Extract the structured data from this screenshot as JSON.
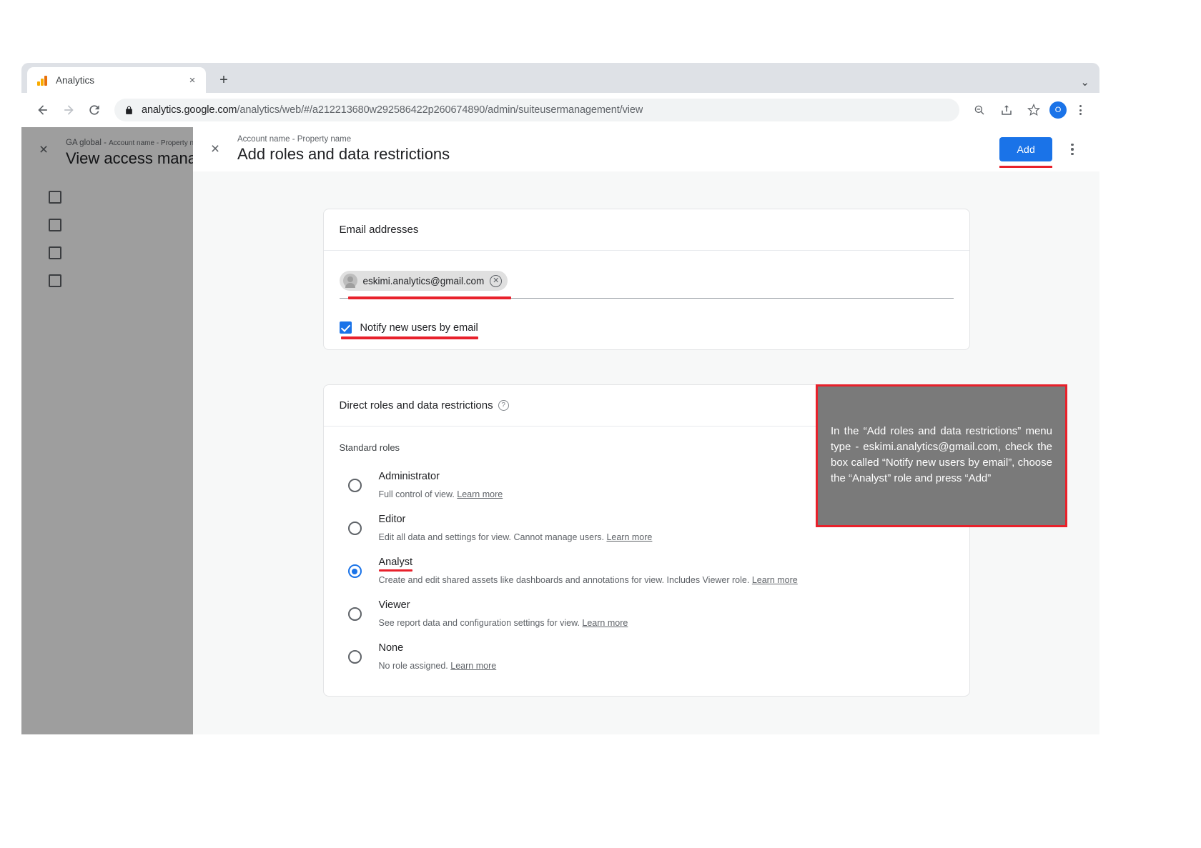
{
  "browser": {
    "tab": {
      "title": "Analytics",
      "favicon": "analytics-bar-chart-icon",
      "close": "×"
    },
    "new_tab": "+",
    "window_chevron": "⌄",
    "nav": {
      "back": "←",
      "forward": "→",
      "reload": "↻"
    },
    "omnibox": {
      "lock": "lock-icon",
      "url_domain": "analytics.google.com",
      "url_path": "/analytics/web/#/a212213680w292586422p260674890/admin/suiteusermanagement/view"
    },
    "toolbar": {
      "zoom_out": "zoom-out-icon",
      "share": "share-icon",
      "bookmark": "☆",
      "avatar_initial": "O",
      "menu": "kebab-menu-icon"
    }
  },
  "background_page": {
    "close": "×",
    "eyebrow_account": "GA global -",
    "eyebrow_overlay": "Account name - Property name",
    "title": "View access manag",
    "row_count": 4
  },
  "dialog": {
    "close": "×",
    "eyebrow": "Account name - Property name",
    "title": "Add roles and data restrictions",
    "add_label": "Add",
    "menu": "kebab-menu-icon",
    "email_card": {
      "heading": "Email addresses",
      "chip": {
        "avatar": "person-avatar-icon",
        "email": "eskimi.analytics@gmail.com",
        "remove": "✕"
      },
      "notify_label": "Notify new users by email",
      "notify_checked": true
    },
    "roles_card": {
      "heading": "Direct roles and data restrictions",
      "help_icon": "?",
      "subheading": "Standard roles",
      "learn_more": "Learn more",
      "selected_role": "Analyst",
      "roles": [
        {
          "name": "Administrator",
          "desc": "Full control of view.",
          "link": "Learn more",
          "selected": false,
          "marked": false
        },
        {
          "name": "Editor",
          "desc": "Edit all data and settings for view. Cannot manage users.",
          "link": "Learn more",
          "selected": false,
          "marked": false
        },
        {
          "name": "Analyst",
          "desc": "Create and edit shared assets like dashboards and annotations for view. Includes Viewer role.",
          "link": "Learn more",
          "selected": true,
          "marked": true
        },
        {
          "name": "Viewer",
          "desc": "See report data and configuration settings for view.",
          "link": "Learn more",
          "selected": false,
          "marked": false
        },
        {
          "name": "None",
          "desc": "No role assigned.",
          "link": "Learn more",
          "selected": false,
          "marked": false
        }
      ]
    }
  },
  "annotation": {
    "text": "In the “Add roles and data restrictions” menu type - eskimi.analytics@gmail.com, check the box called “Notify new users by email”, choose the “Analyst” role and press “Add”"
  },
  "colors": {
    "accent_blue": "#1a73e8",
    "highlight_red": "#e8212b",
    "callout_bg": "#7a7a7a"
  }
}
